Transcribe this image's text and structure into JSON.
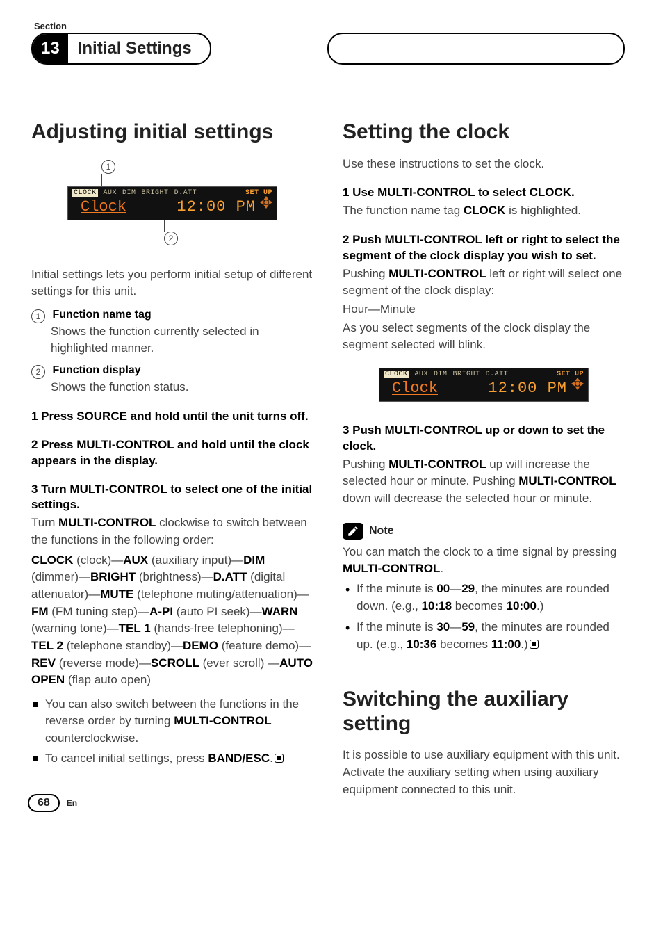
{
  "header": {
    "section_label": "Section",
    "section_number": "13",
    "section_title": "Initial Settings"
  },
  "left": {
    "h1": "Adjusting initial settings",
    "lcd": {
      "tags": [
        "CLOCK",
        "AUX",
        "DIM",
        "BRIGHT",
        "D.ATT"
      ],
      "setup": "SET UP",
      "label": "Clock",
      "time": "12:00 PM"
    },
    "callout1": "1",
    "callout2": "2",
    "intro": "Initial settings lets you perform initial setup of different settings for this unit.",
    "fn1_num": "1",
    "fn1_label": "Function name tag",
    "fn1_body": "Shows the function currently selected in highlighted manner.",
    "fn2_num": "2",
    "fn2_label": "Function display",
    "fn2_body": "Shows the function status.",
    "step1": "1    Press SOURCE and hold until the unit turns off.",
    "step2": "2    Press MULTI-CONTROL and hold until the clock appears in the display.",
    "step3": "3    Turn MULTI-CONTROL to select one of the initial settings.",
    "step3_body_pre": "Turn ",
    "step3_body_mc": "MULTI-CONTROL",
    "step3_body_post": " clockwise to switch between the functions in the following order:",
    "order_parts": [
      {
        "b": "CLOCK",
        "t": " (clock)—"
      },
      {
        "b": "AUX",
        "t": " (auxiliary input)—"
      },
      {
        "b": "DIM",
        "t": " (dimmer)—"
      },
      {
        "b": "BRIGHT",
        "t": " (brightness)—"
      },
      {
        "b": "D.ATT",
        "t": " (digital attenuator)—"
      },
      {
        "b": "MUTE",
        "t": " (telephone muting/attenuation)—"
      },
      {
        "b": "FM",
        "t": " (FM tuning step)—"
      },
      {
        "b": "A-PI",
        "t": " (auto PI seek)—"
      },
      {
        "b": "WARN",
        "t": " (warning tone)—"
      },
      {
        "b": "TEL 1",
        "t": " (hands-free telephoning)—"
      },
      {
        "b": "TEL 2",
        "t": " (telephone standby)—"
      },
      {
        "b": "DEMO",
        "t": " (feature demo)—"
      },
      {
        "b": "REV",
        "t": " (reverse mode)—"
      },
      {
        "b": "SCROLL",
        "t": " (ever scroll) —"
      },
      {
        "b": "AUTO OPEN",
        "t": " (flap auto open)"
      }
    ],
    "note_a_pre": "You can also switch between the functions in the reverse order by turning ",
    "note_a_b": "MULTI-CONTROL",
    "note_a_post": " counterclockwise.",
    "note_b_pre": "To cancel initial settings, press ",
    "note_b_b": "BAND/ESC",
    "note_b_post": "."
  },
  "right": {
    "h1a": "Setting the clock",
    "intro": "Use these instructions to set the clock.",
    "s1": "1    Use MULTI-CONTROL to select CLOCK.",
    "s1_body_pre": "The function name tag ",
    "s1_body_b": "CLOCK",
    "s1_body_post": " is highlighted.",
    "s2": "2    Push MULTI-CONTROL left or right to select the segment of the clock display you wish to set.",
    "s2_body_pre": "Pushing ",
    "s2_body_b": "MULTI-CONTROL",
    "s2_body_mid": " left or right will select one segment of the clock display:",
    "s2_body_hm": "Hour—Minute",
    "s2_body_tail": "As you select segments of the clock display the segment selected will blink.",
    "lcd": {
      "tags": [
        "CLOCK",
        "AUX",
        "DIM",
        "BRIGHT",
        "D.ATT"
      ],
      "setup": "SET UP",
      "label": "Clock",
      "time": "12:00 PM"
    },
    "s3": "3    Push MULTI-CONTROL up or down to set the clock.",
    "s3_body_pre": "Pushing ",
    "s3_body_b1": "MULTI-CONTROL",
    "s3_body_mid": " up will increase the selected hour or minute. Pushing ",
    "s3_body_b2": "MULTI-CONTROL",
    "s3_body_post": " down will decrease the selected hour or minute.",
    "note_label": "Note",
    "note_body_pre": "You can match the clock to a time signal by pressing ",
    "note_body_b": "MULTI-CONTROL",
    "note_body_post": ".",
    "nb1_pre": "If the minute is ",
    "nb1_b1": "00",
    "nb1_dash": "—",
    "nb1_b2": "29",
    "nb1_mid": ", the minutes are rounded down. (e.g., ",
    "nb1_b3": "10:18",
    "nb1_becomes": " becomes ",
    "nb1_b4": "10:00",
    "nb1_post": ".)",
    "nb2_pre": "If the minute is ",
    "nb2_b1": "30",
    "nb2_dash": "—",
    "nb2_b2": "59",
    "nb2_mid": ", the minutes are rounded up. (e.g., ",
    "nb2_b3": "10:36",
    "nb2_becomes": " becomes ",
    "nb2_b4": "11:00",
    "nb2_post": ".)",
    "h1b": "Switching the auxiliary setting",
    "aux_body": "It is possible to use auxiliary equipment with this unit. Activate the auxiliary setting when using auxiliary equipment connected to this unit."
  },
  "footer": {
    "page": "68",
    "lang": "En"
  }
}
